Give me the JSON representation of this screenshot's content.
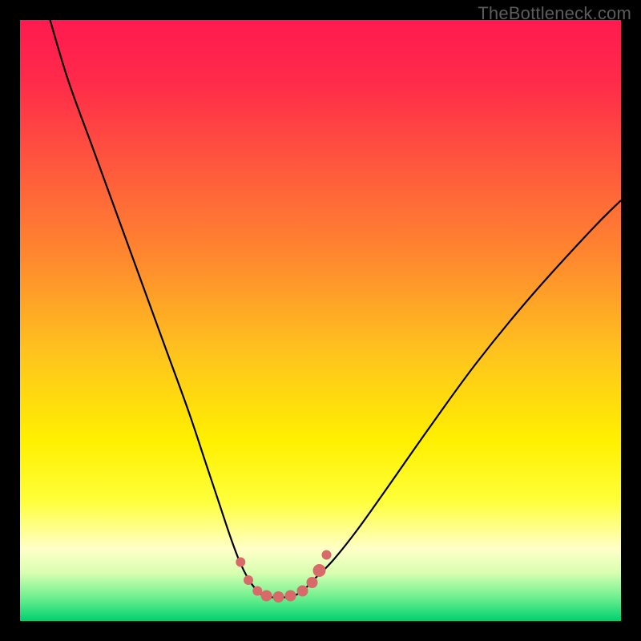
{
  "watermark": "TheBottleneck.com",
  "colors": {
    "frame": "#000000",
    "gradient_stops": [
      {
        "offset": 0.0,
        "color": "#ff1a4f"
      },
      {
        "offset": 0.1,
        "color": "#ff2a4a"
      },
      {
        "offset": 0.25,
        "color": "#ff5a3c"
      },
      {
        "offset": 0.4,
        "color": "#ff8a2e"
      },
      {
        "offset": 0.55,
        "color": "#ffc21e"
      },
      {
        "offset": 0.7,
        "color": "#fff000"
      },
      {
        "offset": 0.8,
        "color": "#ffff3a"
      },
      {
        "offset": 0.88,
        "color": "#ffffc8"
      },
      {
        "offset": 0.92,
        "color": "#d8ffb0"
      },
      {
        "offset": 0.96,
        "color": "#70f090"
      },
      {
        "offset": 1.0,
        "color": "#00d070"
      }
    ],
    "curve": "#000000",
    "marker_fill": "#d86a6a",
    "marker_stroke": "#d86a6a"
  },
  "chart_data": {
    "type": "line",
    "title": "",
    "xlabel": "",
    "ylabel": "",
    "xlim": [
      0,
      100
    ],
    "ylim": [
      0,
      100
    ],
    "series": [
      {
        "name": "bottleneck-curve",
        "x": [
          5,
          8,
          12,
          16,
          20,
          24,
          28,
          31,
          33,
          35,
          36.5,
          38,
          39.5,
          41,
          43,
          45,
          47,
          49,
          52,
          56,
          61,
          68,
          76,
          85,
          95,
          100
        ],
        "y": [
          100,
          90,
          79,
          68,
          57,
          46,
          35,
          26,
          20,
          14,
          10,
          7,
          5,
          4,
          4,
          4,
          5,
          7,
          10,
          15,
          22,
          32,
          43,
          54,
          65,
          70
        ]
      }
    ],
    "markers": {
      "name": "highlight-valley",
      "x": [
        36.7,
        38.0,
        39.5,
        41.0,
        43.0,
        45.0,
        47.0,
        48.6,
        49.8,
        51.0
      ],
      "y": [
        9.8,
        6.8,
        5.0,
        4.2,
        4.0,
        4.2,
        5.0,
        6.4,
        8.4,
        11.0
      ],
      "r": [
        6,
        6,
        6,
        7,
        7,
        7,
        7,
        7,
        8,
        6
      ]
    }
  }
}
